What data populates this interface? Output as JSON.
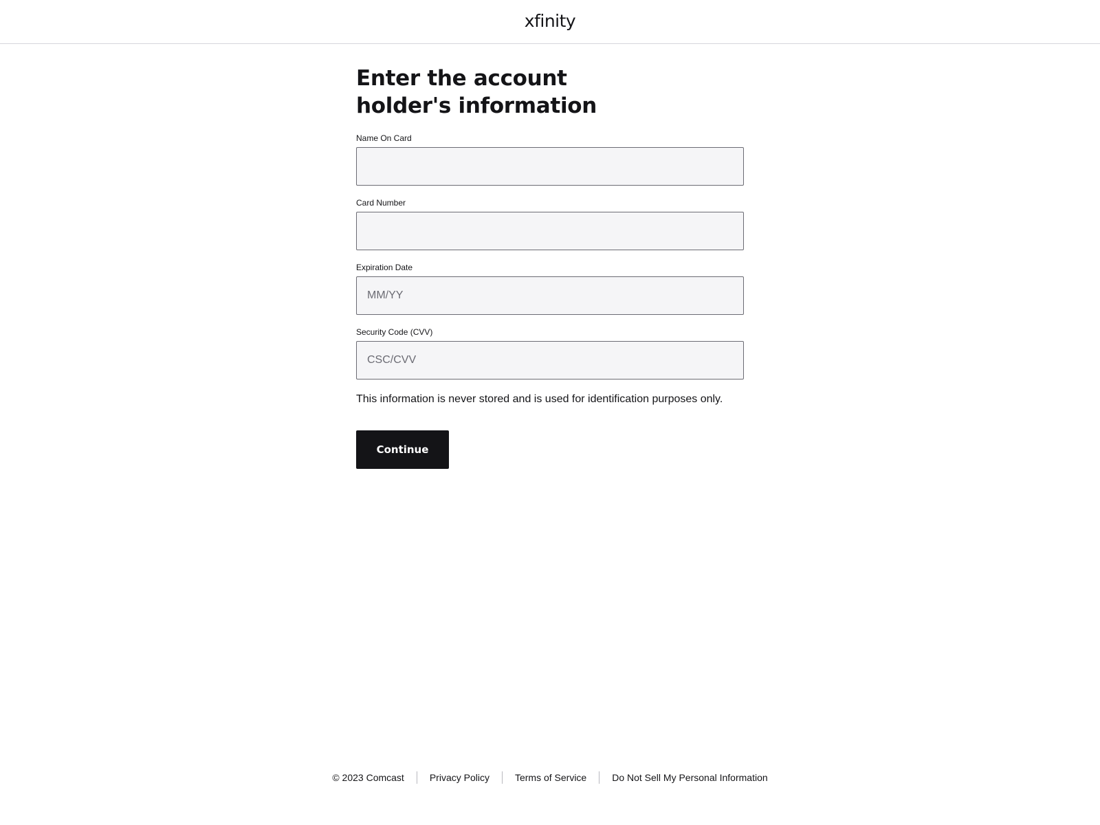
{
  "header": {
    "logo_text": "xfinity"
  },
  "form": {
    "title": "Enter the account holder's information",
    "fields": [
      {
        "label": "Name On Card",
        "value": "",
        "placeholder": ""
      },
      {
        "label": "Card Number",
        "value": "",
        "placeholder": ""
      },
      {
        "label": "Expiration Date",
        "value": "",
        "placeholder": "MM/YY"
      },
      {
        "label": "Security Code (CVV)",
        "value": "",
        "placeholder": "CSC/CVV"
      }
    ],
    "note": "This information is never stored and is used for identification purposes only.",
    "continue_label": "Continue"
  },
  "footer": {
    "copyright": "© 2023 Comcast",
    "links": [
      "Privacy Policy",
      "Terms of Service",
      "Do Not Sell My Personal Information"
    ]
  },
  "colors": {
    "text": "#141417",
    "button_bg": "#141417",
    "input_bg": "#f5f5f7",
    "input_border": "#6b6b73",
    "divider": "#d6d6dc"
  }
}
